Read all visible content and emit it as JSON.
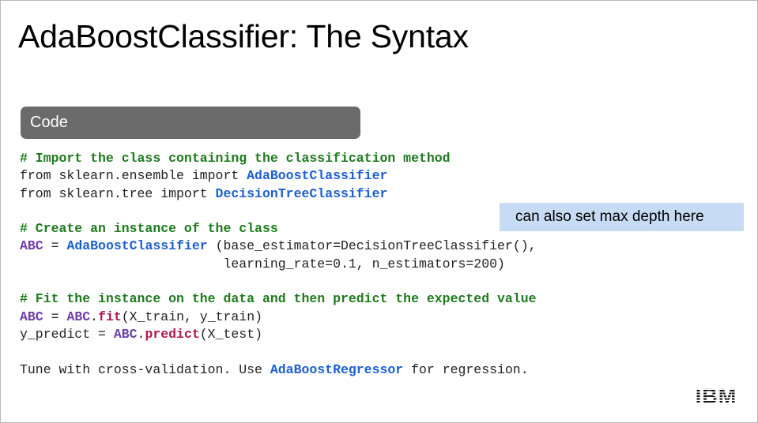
{
  "slide": {
    "title": "AdaBoostClassifier: The Syntax",
    "code_header": "Code",
    "note": "can also set max depth here",
    "logo_text": "IBM"
  },
  "code": {
    "l1_comment": "# Import the class containing the classification method",
    "l2_a": "from sklearn.ensemble import ",
    "l2_b": "AdaBoostClassifier",
    "l3_a": "from sklearn.tree import ",
    "l3_b": "DecisionTreeClassifier",
    "l5_comment": "# Create an instance of the class",
    "l6_var": "ABC",
    "l6_eq": " = ",
    "l6_cls": "AdaBoostClassifier",
    "l6_rest": " (base_estimator=DecisionTreeClassifier(),",
    "l7": "                          learning_rate=0.1, n_estimators=200)",
    "l9_comment": "# Fit the instance on the data and then predict the expected value",
    "l10_var": "ABC",
    "l10_eq": " = ",
    "l10_var2": "ABC",
    "l10_dot": ".",
    "l10_fn": "fit",
    "l10_rest": "(X_train, y_train)",
    "l11_a": "y_predict = ",
    "l11_var": "ABC",
    "l11_dot": ".",
    "l11_fn": "predict",
    "l11_rest": "(X_test)",
    "l13_a": "Tune with cross-validation. Use ",
    "l13_cls": "AdaBoostRegressor",
    "l13_b": " for regression."
  },
  "colors": {
    "comment": "#1d7a1d",
    "class": "#1c5fcf",
    "variable": "#6c3fa8",
    "function": "#b0164c",
    "code_header_bg": "#6b6b6b",
    "note_bg": "#c7dbf4"
  },
  "icons": {
    "logo": "ibm-logo"
  }
}
